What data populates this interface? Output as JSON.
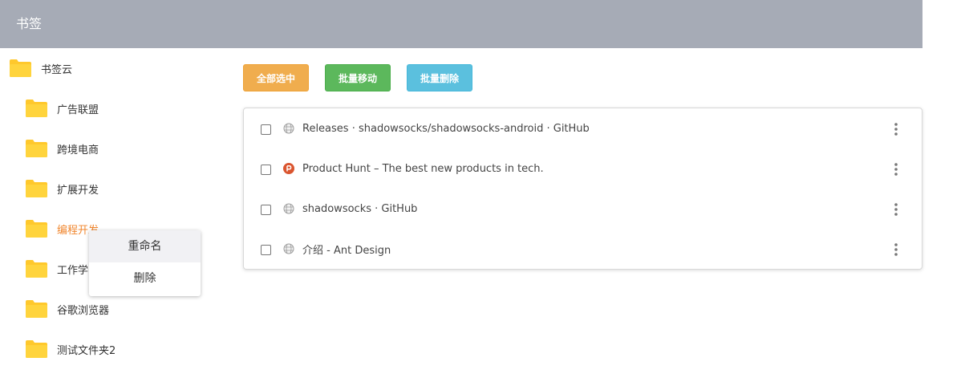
{
  "header": {
    "title": "书签"
  },
  "sidebar": {
    "root": {
      "label": "书签云",
      "icon": "folder-icon"
    },
    "items": [
      {
        "label": "广告联盟",
        "icon": "folder-icon"
      },
      {
        "label": "跨境电商",
        "icon": "folder-icon"
      },
      {
        "label": "扩展开发",
        "icon": "folder-icon"
      },
      {
        "label": "编程开发",
        "icon": "folder-icon",
        "active": true
      },
      {
        "label": "工作学",
        "icon": "folder-icon"
      },
      {
        "label": "谷歌浏览器",
        "icon": "folder-icon"
      },
      {
        "label": "测试文件夹2",
        "icon": "folder-icon"
      }
    ]
  },
  "context_menu": {
    "items": [
      {
        "label": "重命名"
      },
      {
        "label": "删除"
      }
    ]
  },
  "toolbar": {
    "select_all_label": "全部选中",
    "batch_move_label": "批量移动",
    "batch_delete_label": "批量删除"
  },
  "bookmarks": [
    {
      "title": "Releases · shadowsocks/shadowsocks-android · GitHub",
      "icon": "globe-icon",
      "checked": false
    },
    {
      "title": "Product Hunt – The best new products in tech.",
      "icon": "product-hunt-icon",
      "checked": false
    },
    {
      "title": "shadowsocks · GitHub",
      "icon": "globe-icon",
      "checked": false
    },
    {
      "title": "介绍 - Ant Design",
      "icon": "globe-icon",
      "checked": false
    }
  ],
  "colors": {
    "header_bg": "#a6abb6",
    "folder": "#ffc82c",
    "active_text": "#f0862e",
    "select_all": "#f0ad4e",
    "batch_move": "#5cb85c",
    "batch_delete": "#5bc0de",
    "product_hunt": "#da552f"
  }
}
